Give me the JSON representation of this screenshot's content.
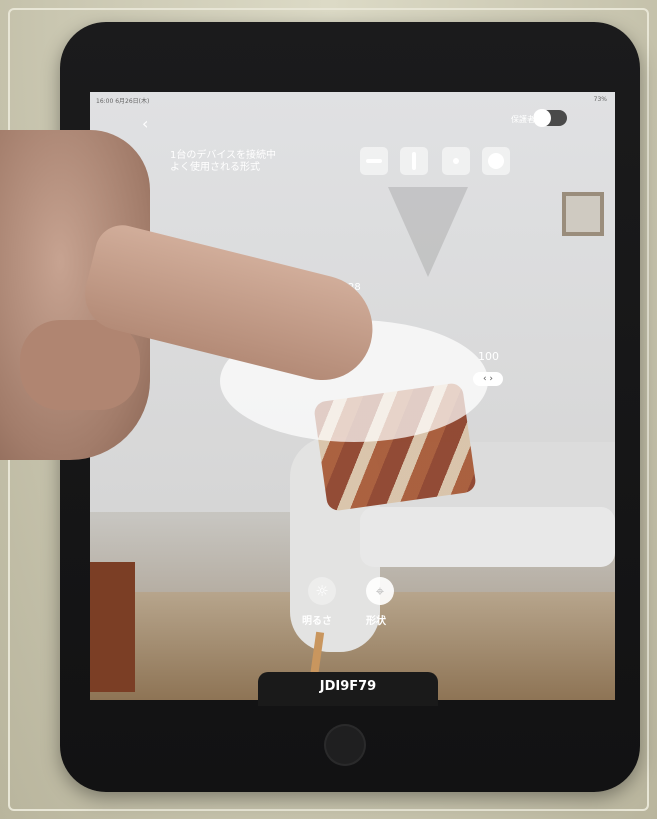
{
  "status_bar": {
    "time": "16:00 6月26日(木)",
    "battery": "73%"
  },
  "top_bar": {
    "back_icon": "chevron-left-icon",
    "toggle_label": "保護者",
    "toggle_on": false
  },
  "devices_info": {
    "line1": "1台のデバイスを接続中",
    "line2": "よく使用される形式"
  },
  "shape_buttons": [
    {
      "icon": "horizontal-bar-icon"
    },
    {
      "icon": "vertical-bar-icon"
    },
    {
      "icon": "dot-icon"
    },
    {
      "icon": "circle-icon"
    }
  ],
  "ellipse_control": {
    "top_value": "28",
    "right_value": "100",
    "handle_icon": "left-right-arrows-icon"
  },
  "bottom_controls": [
    {
      "label": "明るさ",
      "icon": "brightness-icon"
    },
    {
      "label": "形状",
      "icon": "shape-target-icon"
    }
  ],
  "device_name": "JDI9F79"
}
